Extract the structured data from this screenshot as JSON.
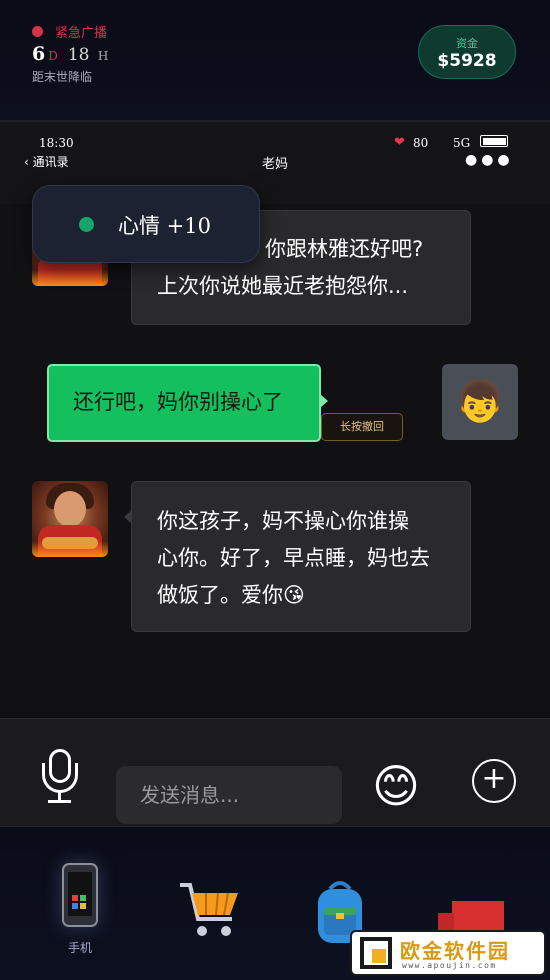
{
  "hud": {
    "alert": "紧急广播",
    "days_value": "6",
    "days_unit": "D",
    "hours_value": "18",
    "hours_unit": "H",
    "countdown_label": "距末世降临",
    "money_label": "资金",
    "money_amount": "$5928"
  },
  "statusbar": {
    "time": "18:30",
    "back_label": "通讯录",
    "contact_name": "老妈",
    "health": "80",
    "network": "5G",
    "more": "●●●"
  },
  "toast": {
    "text": "心情 +10"
  },
  "messages": [
    {
      "from": "contact",
      "text_line1": "你跟林雅还好吧?",
      "text_line2": "上次你说她最近老抱怨你..."
    },
    {
      "from": "me",
      "text": "还行吧，妈你别操心了",
      "recall_label": "长按撤回",
      "avatar_emoji": "👦"
    },
    {
      "from": "contact",
      "text_line1": "你这孩子，妈不操心你谁操",
      "text_line2": "心你。好了，早点睡，妈也去",
      "text_line3": "做饭了。爱你😘"
    }
  ],
  "input": {
    "placeholder": "发送消息...",
    "emoji": "😊",
    "plus": "+"
  },
  "dock": {
    "phone_label": "手机"
  },
  "watermark": {
    "name": "欧金软件园",
    "url": "www.apoujin.com"
  },
  "colors": {
    "accent_green": "#14c05e",
    "alert_red": "#d8324b",
    "money_green": "#3fcc9a"
  }
}
